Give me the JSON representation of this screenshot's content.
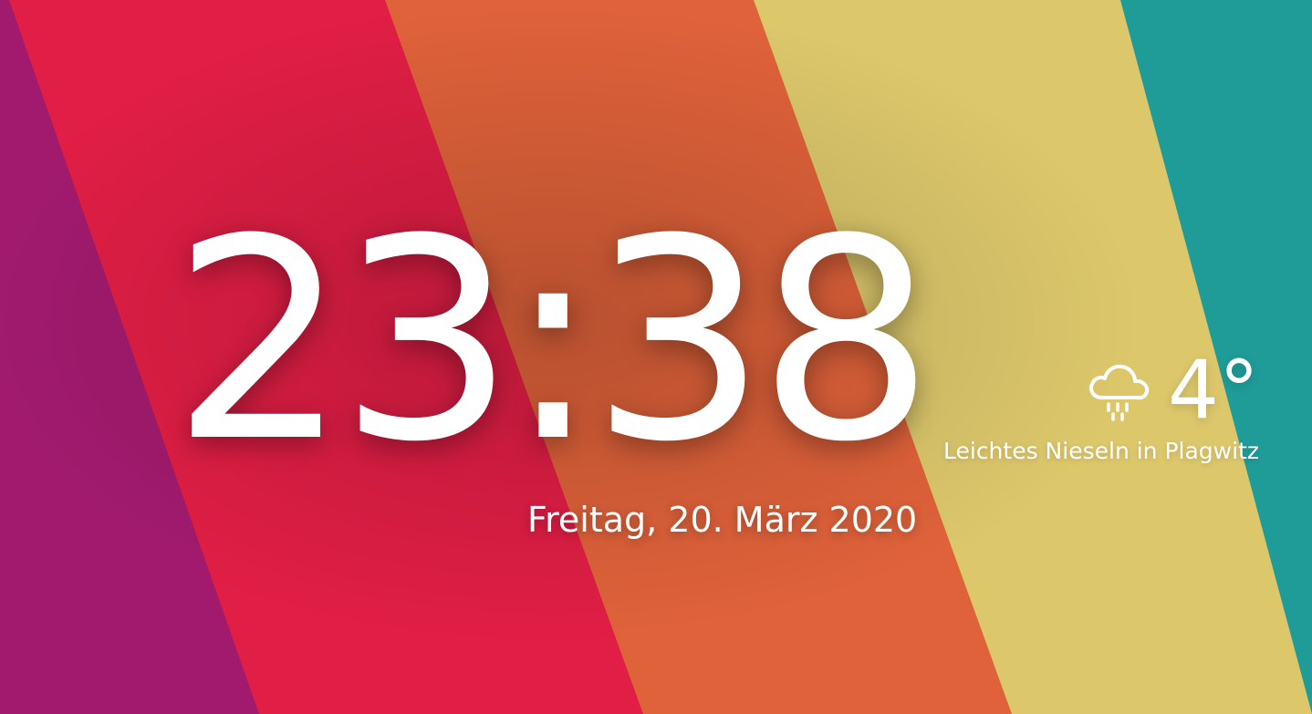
{
  "clock": {
    "time": "23:38",
    "date": "Freitag, 20. März 2020"
  },
  "weather": {
    "icon": "cloud-drizzle-icon",
    "temperature": "4°",
    "description": "Leichtes Nieseln in Plagwitz"
  },
  "background": {
    "colors": [
      "#a21a6e",
      "#e11e45",
      "#e0623a",
      "#dcc76b",
      "#1f9b98"
    ]
  }
}
